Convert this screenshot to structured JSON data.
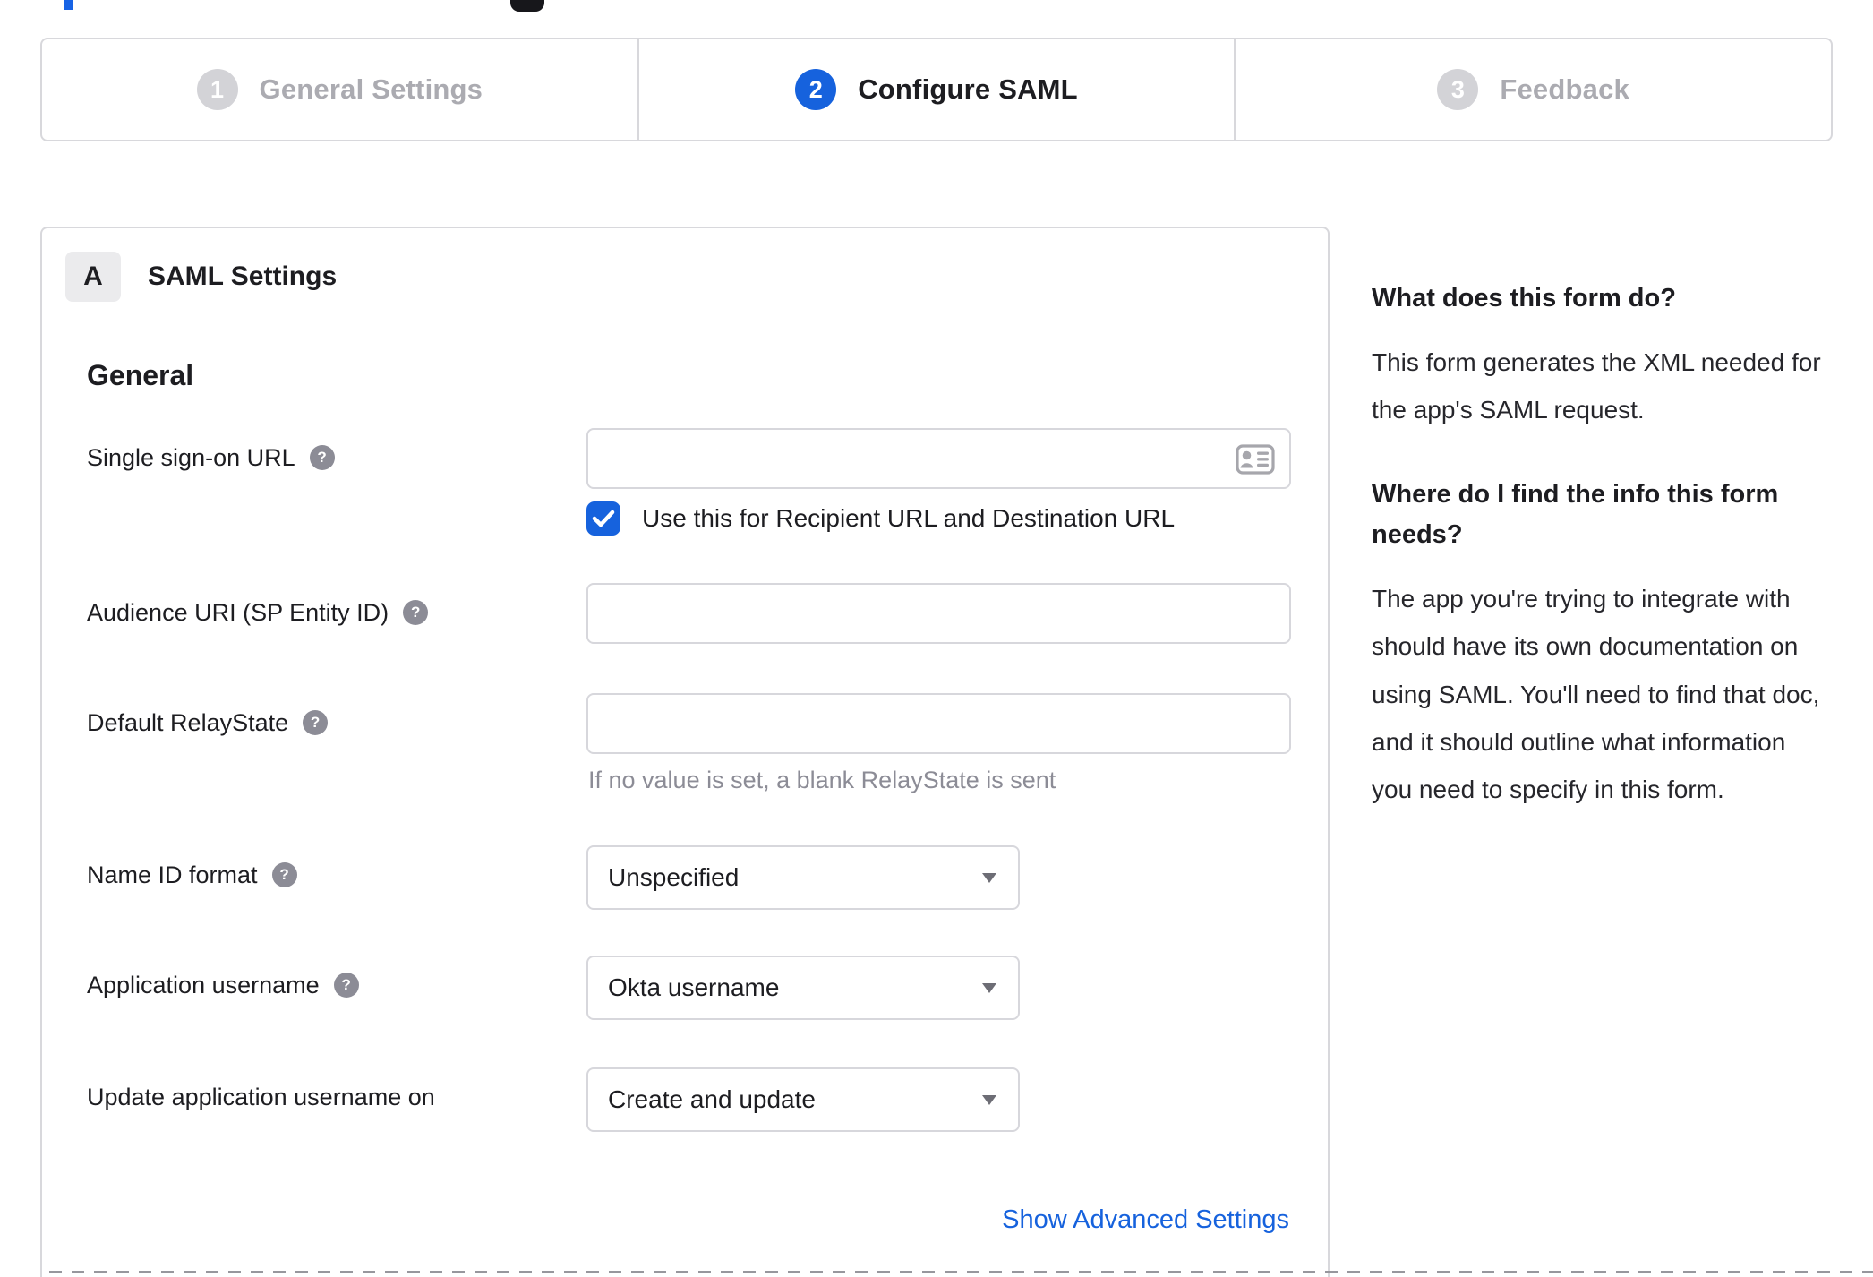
{
  "colors": {
    "accent": "#1662dd",
    "border": "#d8d8dc",
    "muted_text": "#8c8c96",
    "text": "#1d1d21",
    "inactive_step": "#d3d3d7"
  },
  "stepper": {
    "steps": [
      {
        "number": "1",
        "label": "General Settings",
        "active": false
      },
      {
        "number": "2",
        "label": "Configure SAML",
        "active": true
      },
      {
        "number": "3",
        "label": "Feedback",
        "active": false
      }
    ]
  },
  "saml_panel": {
    "badge": "A",
    "title": "SAML Settings",
    "section": "General",
    "fields": [
      {
        "label": "Single sign-on URL",
        "value": "",
        "checkbox_label": "Use this for Recipient URL and Destination URL",
        "checkbox_checked": true
      },
      {
        "label": "Audience URI (SP Entity ID)",
        "value": ""
      },
      {
        "label": "Default RelayState",
        "value": "",
        "hint": "If no value is set, a blank RelayState is sent"
      },
      {
        "label": "Name ID format",
        "value": "Unspecified"
      },
      {
        "label": "Application username",
        "value": "Okta username"
      },
      {
        "label": "Update application username on",
        "value": "Create and update"
      }
    ],
    "advanced_link": "Show Advanced Settings"
  },
  "help_panel": {
    "q1": "What does this form do?",
    "a1": "This form generates the XML needed for the app's SAML request.",
    "q2": "Where do I find the info this form needs?",
    "a2": "The app you're trying to integrate with should have its own documentation on using SAML. You'll need to find that doc, and it should outline what information you need to specify in this form."
  }
}
